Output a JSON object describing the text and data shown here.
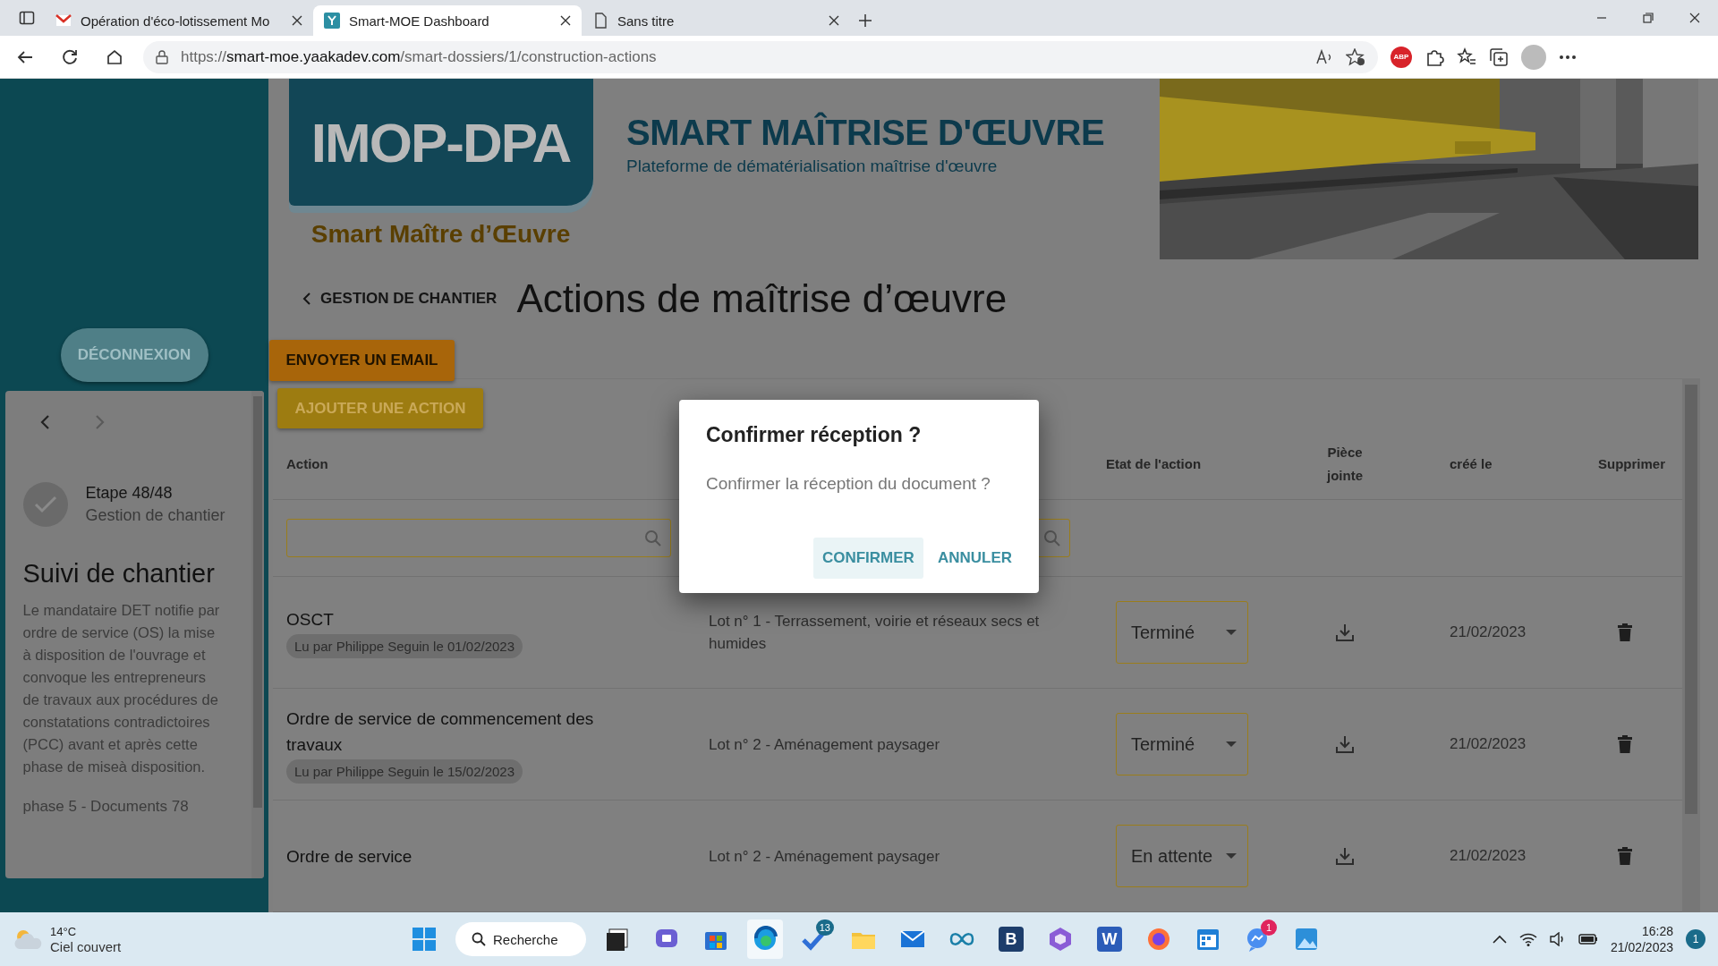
{
  "browser": {
    "tabs": [
      {
        "title": "Opération d'éco-lotissement Mo",
        "kind": "mail",
        "selected": false
      },
      {
        "title": "Smart-MOE Dashboard",
        "kind": "site",
        "selected": true
      },
      {
        "title": "Sans titre",
        "kind": "page",
        "selected": false
      }
    ],
    "url": {
      "scheme": "https://",
      "host": "smart-moe.yaakadev.com",
      "path": "/smart-dossiers/1/construction-actions"
    },
    "adblock_label": "ABP"
  },
  "header": {
    "logo_text": "IMOP-DPA",
    "logo_caption": "Smart Maître d’Œuvre",
    "title": "SMART MAÎTRISE D'ŒUVRE",
    "subtitle": "Plateforme de dématérialisation maîtrise d'œuvre"
  },
  "sidebar": {
    "logout": "DÉCONNEXION",
    "step": {
      "label": "Etape 48/48",
      "name": "Gestion de chantier",
      "done": true
    },
    "section_title": "Suivi de chantier",
    "description": "Le mandataire DET notifie par ordre de service (OS) la mise à disposition de l'ouvrage et convoque les entrepreneurs de travaux aux procédures de constatations contradictoires (PCC) avant et après cette phase de miseà disposition.",
    "note": "phase 5 - Documents 78"
  },
  "page": {
    "back_link": "GESTION DE CHANTIER",
    "heading": "Actions de maîtrise d’œuvre",
    "email_button": "ENVOYER UN EMAIL"
  },
  "table": {
    "add_button": "AJOUTER UNE ACTION",
    "columns": [
      "Action",
      "Etat de l'action",
      "Pièce jointe",
      "créé le",
      "Supprimer"
    ],
    "rows": [
      {
        "action": "OSCT",
        "read_note": "Lu par Philippe Seguin le 01/02/2023",
        "lot": "Lot n° 1 - Terrassement, voirie et réseaux secs et humides",
        "status": "Terminé",
        "created": "21/02/2023"
      },
      {
        "action": "Ordre de service de commencement des travaux",
        "read_note": "Lu par Philippe Seguin le 15/02/2023",
        "lot": "Lot n° 2 - Aménagement paysager",
        "status": "Terminé",
        "created": "21/02/2023"
      },
      {
        "action": "Ordre de service",
        "lot": "Lot n° 2 - Aménagement paysager",
        "status": "En attente",
        "created": "21/02/2023"
      }
    ]
  },
  "dialog": {
    "title": "Confirmer réception ?",
    "message": "Confirmer la réception du document ?",
    "buttons": [
      {
        "label": "CONFIRMER",
        "focused": true
      },
      {
        "label": "ANNULER",
        "focused": false
      }
    ]
  },
  "taskbar": {
    "weather": {
      "temp": "14°C",
      "condition": "Ciel couvert"
    },
    "search": "Recherche",
    "apps": [
      {
        "kind": "start",
        "selected": false
      },
      {
        "kind": "search"
      },
      {
        "kind": "taskview",
        "selected": false
      },
      {
        "kind": "chat",
        "selected": false
      },
      {
        "kind": "store",
        "selected": false
      },
      {
        "kind": "edge",
        "selected": true
      },
      {
        "kind": "todo",
        "badge": "13",
        "selected": false
      },
      {
        "kind": "folder",
        "selected": false
      },
      {
        "kind": "mail",
        "selected": false
      },
      {
        "kind": "infinity",
        "selected": false
      },
      {
        "kind": "letter",
        "label": "B",
        "selected": false
      },
      {
        "kind": "hexagon",
        "selected": false
      },
      {
        "kind": "word",
        "label": "W",
        "selected": false
      },
      {
        "kind": "firefox",
        "selected": false
      },
      {
        "kind": "calendar",
        "selected": false
      },
      {
        "kind": "messenger",
        "badge": "1",
        "selected": false
      },
      {
        "kind": "photos",
        "selected": false
      }
    ],
    "time": "16:28",
    "date": "21/02/2023",
    "notifications": "1"
  }
}
